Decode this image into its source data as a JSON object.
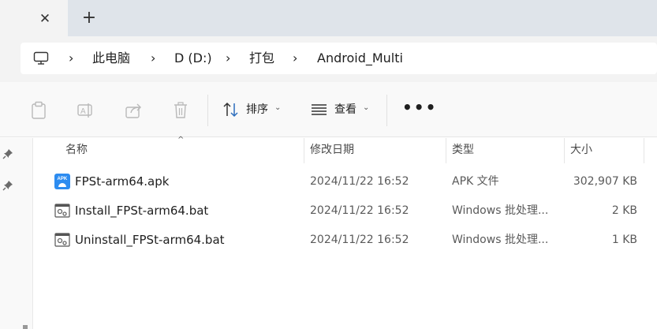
{
  "tabs": {
    "close_glyph": "✕",
    "new_tab_glyph": "+"
  },
  "breadcrumb": {
    "items": [
      "此电脑",
      "D (D:)",
      "打包",
      "Android_Multi"
    ],
    "separator": "›"
  },
  "toolbar": {
    "sort_label": "排序",
    "view_label": "查看",
    "more_label": "•••"
  },
  "columns": {
    "name": "名称",
    "modified": "修改日期",
    "type": "类型",
    "size": "大小"
  },
  "files": [
    {
      "name": "FPSt-arm64.apk",
      "modified": "2024/11/22 16:52",
      "type": "APK 文件",
      "size": "302,907 KB",
      "icon": "apk-icon"
    },
    {
      "name": "Install_FPSt-arm64.bat",
      "modified": "2024/11/22 16:52",
      "type": "Windows 批处理...",
      "size": "2 KB",
      "icon": "batch-file-icon"
    },
    {
      "name": "Uninstall_FPSt-arm64.bat",
      "modified": "2024/11/22 16:52",
      "type": "Windows 批处理...",
      "size": "1 KB",
      "icon": "batch-file-icon"
    }
  ],
  "colors": {
    "accent": "#2d8cf0",
    "tabstrip": "#dfe4ea",
    "toolbar_bg": "#f9f9f9"
  }
}
